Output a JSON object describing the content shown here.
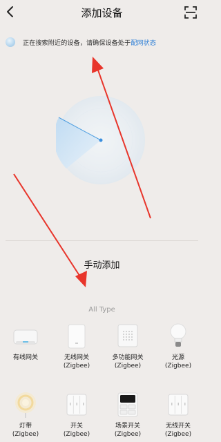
{
  "header": {
    "title": "添加设备"
  },
  "status": {
    "text": "正在搜索附近的设备，请确保设备处于",
    "link": "配网状态"
  },
  "manual": {
    "title": "手动添加"
  },
  "category": {
    "label": "All Type"
  },
  "devices": [
    {
      "line1": "有线网关",
      "line2": "",
      "icon": "wired-gateway-icon"
    },
    {
      "line1": "无线网关",
      "line2": "(Zigbee)",
      "icon": "wireless-gateway-icon"
    },
    {
      "line1": "多功能网关",
      "line2": "(Zigbee)",
      "icon": "multi-gateway-icon"
    },
    {
      "line1": "光源",
      "line2": "(Zigbee)",
      "icon": "bulb-icon"
    },
    {
      "line1": "灯带",
      "line2": "(Zigbee)",
      "icon": "light-strip-icon"
    },
    {
      "line1": "开关",
      "line2": "(Zigbee)",
      "icon": "switch-icon"
    },
    {
      "line1": "场景开关",
      "line2": "(Zigbee)",
      "icon": "scene-switch-icon"
    },
    {
      "line1": "无线开关",
      "line2": "(Zigbee)",
      "icon": "wireless-switch-icon"
    }
  ],
  "colors": {
    "background": "#efecea",
    "link": "#2e7fd6",
    "radar": "#a9cdec",
    "annotation_arrow": "#e8352b"
  }
}
